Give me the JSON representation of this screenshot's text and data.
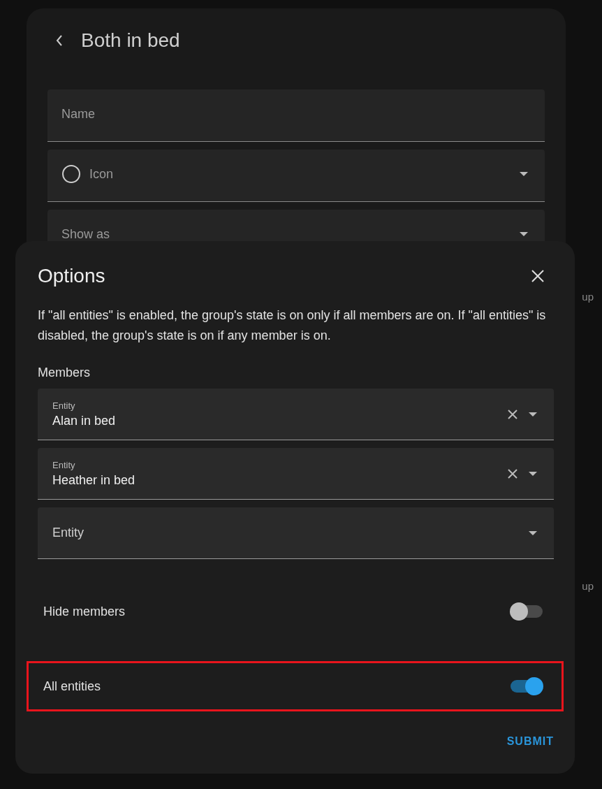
{
  "page": {
    "side_labels": [
      "up",
      "up"
    ]
  },
  "editor": {
    "title": "Both in bed",
    "fields": [
      {
        "label": "Name",
        "kind": "text"
      },
      {
        "label": "Icon",
        "kind": "icon-select"
      },
      {
        "label": "Show as",
        "kind": "select"
      }
    ]
  },
  "dialog": {
    "title": "Options",
    "description": "If \"all entities\" is enabled, the group's state is on only if all members are on. If \"all entities\" is disabled, the group's state is on if any member is on.",
    "members_heading": "Members",
    "members": [
      {
        "label": "Entity",
        "value": "Alan in bed"
      },
      {
        "label": "Entity",
        "value": "Heather in bed"
      },
      {
        "label": "Entity"
      }
    ],
    "toggles": [
      {
        "label": "Hide members",
        "on": false,
        "highlighted": false
      },
      {
        "label": "All entities",
        "on": true,
        "highlighted": true
      }
    ],
    "submit": "SUBMIT"
  }
}
